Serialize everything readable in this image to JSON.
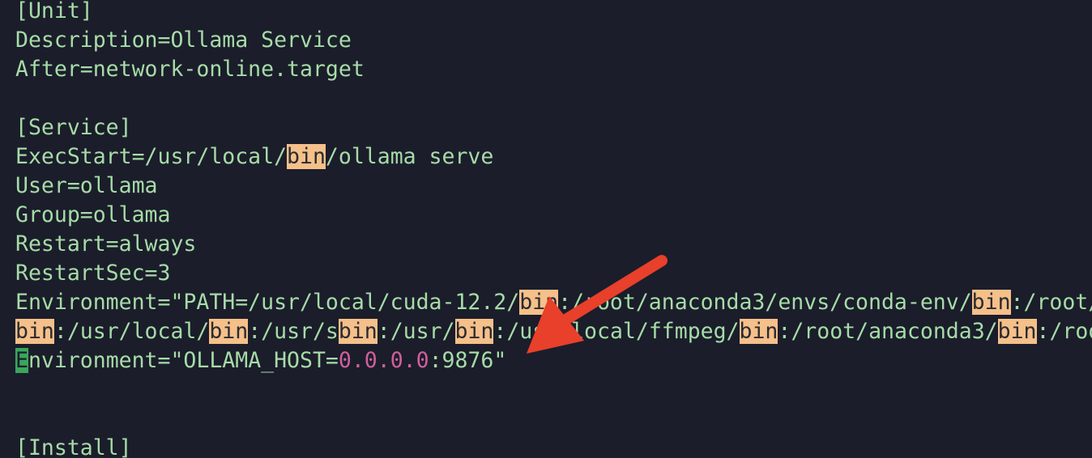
{
  "editor": {
    "lines": [
      [
        {
          "t": "[Unit]"
        }
      ],
      [
        {
          "t": "Description=Ollama Service"
        }
      ],
      [
        {
          "t": "After=network-online.target"
        }
      ],
      [
        {
          "t": ""
        }
      ],
      [
        {
          "t": "[Service]"
        }
      ],
      [
        {
          "t": "ExecStart=/usr/local/"
        },
        {
          "t": "bin",
          "s": "hl"
        },
        {
          "t": "/ollama serve"
        }
      ],
      [
        {
          "t": "User=ollama"
        }
      ],
      [
        {
          "t": "Group=ollama"
        }
      ],
      [
        {
          "t": "Restart=always"
        }
      ],
      [
        {
          "t": "RestartSec=3"
        }
      ],
      [
        {
          "t": "Environment=\"PATH=/usr/local/cuda-12.2/"
        },
        {
          "t": "bin",
          "s": "hl"
        },
        {
          "t": ":/root/anaconda3/envs/conda-env/"
        },
        {
          "t": "bin",
          "s": "hl"
        },
        {
          "t": ":/root/"
        }
      ],
      [
        {
          "t": "bin",
          "s": "hl"
        },
        {
          "t": ":/usr/local/"
        },
        {
          "t": "bin",
          "s": "hl"
        },
        {
          "t": ":/usr/s"
        },
        {
          "t": "bin",
          "s": "hl"
        },
        {
          "t": ":/usr/"
        },
        {
          "t": "bin",
          "s": "hl"
        },
        {
          "t": ":/usr/local/ffmpeg/"
        },
        {
          "t": "bin",
          "s": "hl"
        },
        {
          "t": ":/root/anaconda3/"
        },
        {
          "t": "bin",
          "s": "hl"
        },
        {
          "t": ":/root"
        }
      ],
      [
        {
          "t": "E",
          "s": "cursor"
        },
        {
          "t": "nvironment=\"OLLAMA_HOST="
        },
        {
          "t": "0.0.0.0",
          "s": "num"
        },
        {
          "t": ":9876\""
        }
      ],
      [
        {
          "t": ""
        }
      ],
      [
        {
          "t": ""
        }
      ],
      [
        {
          "t": "[Install]"
        }
      ]
    ]
  },
  "colors": {
    "background": "#1b1d2b",
    "text": "#a6dca7",
    "search_highlight": "#f5c089",
    "number": "#cf5f9c",
    "cursor": "#3aa65c",
    "annotation_arrow": "#e8402a"
  },
  "annotation": {
    "icon": "red-arrow-icon"
  }
}
